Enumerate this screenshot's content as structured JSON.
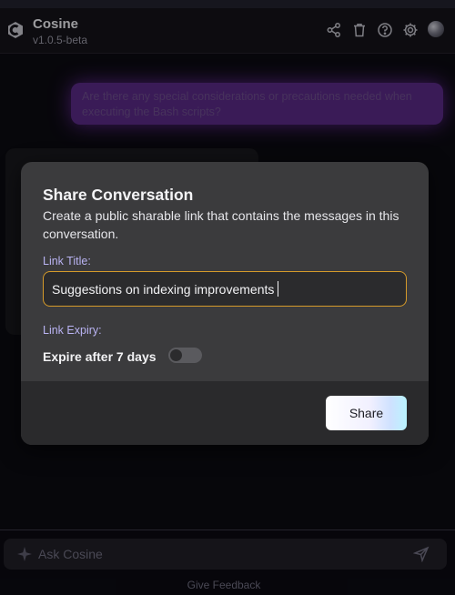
{
  "app": {
    "name": "Cosine",
    "version": "v1.0.5-beta"
  },
  "header": {
    "icons": [
      "share-icon",
      "trash-icon",
      "help-icon",
      "gear-icon",
      "avatar"
    ]
  },
  "chat": {
    "user_message": "Are there any special considerations or precautions needed when executing the Bash scripts?"
  },
  "modal": {
    "title": "Share Conversation",
    "description": "Create a public sharable link that contains the messages in this conversation.",
    "link_title_label": "Link Title:",
    "link_title_value": "Suggestions on indexing improvements",
    "link_expiry_label": "Link Expiry:",
    "expire_text": "Expire after 7 days",
    "expire_toggle_on": false,
    "share_button": "Share"
  },
  "composer": {
    "placeholder": "Ask Cosine",
    "feedback_link": "Give Feedback"
  },
  "colors": {
    "accent_border": "#d59a2a",
    "label_color": "#b9b3f2",
    "user_bubble": "#5a2a86"
  }
}
